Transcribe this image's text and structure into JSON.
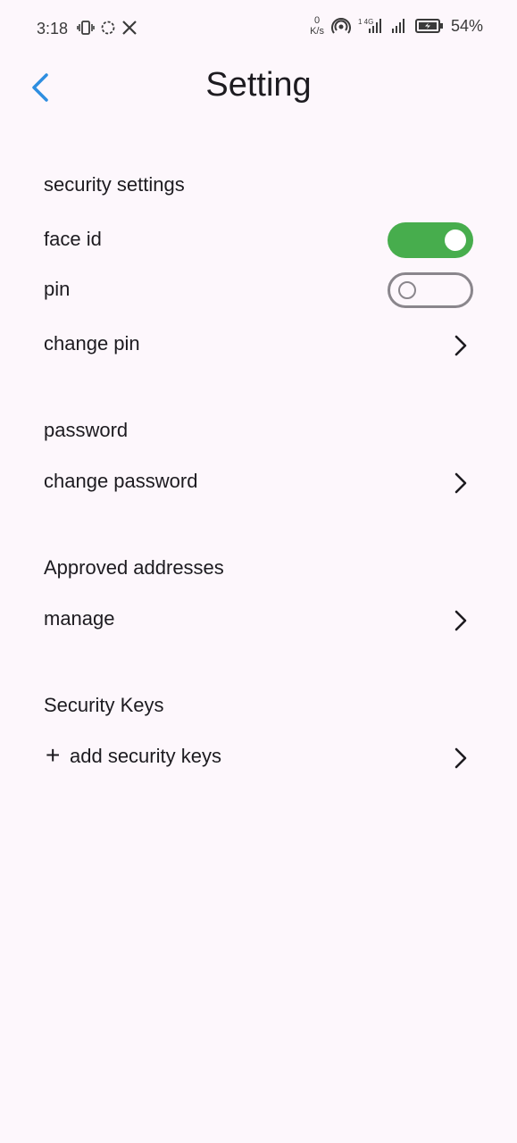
{
  "status_bar": {
    "time": "3:18",
    "net_speed_value": "0",
    "net_speed_unit": "K/s",
    "battery_percent": "54%",
    "left_icons": [
      "vibrate-icon",
      "sync-icon",
      "x-logo-icon"
    ],
    "right_icons": [
      "hotspot-icon",
      "signal-4g-icon",
      "signal-icon",
      "battery-charging-icon"
    ]
  },
  "header": {
    "title": "Setting",
    "back_icon": "chevron-left-icon",
    "accent_color": "#2e8ee0"
  },
  "sections": {
    "security": {
      "title": "security settings",
      "face_id_label": "face id",
      "face_id_enabled": true,
      "pin_label": "pin",
      "pin_enabled": false,
      "change_pin_label": "change pin"
    },
    "password": {
      "title": "password",
      "change_password_label": "change password"
    },
    "addresses": {
      "title": "Approved addresses",
      "manage_label": "manage"
    },
    "keys": {
      "title": "Security Keys",
      "add_plus": "+",
      "add_label": "add security keys"
    }
  },
  "colors": {
    "background": "#fdf7fc",
    "toggle_on": "#47ad4d",
    "toggle_off_border": "#8a868c"
  }
}
